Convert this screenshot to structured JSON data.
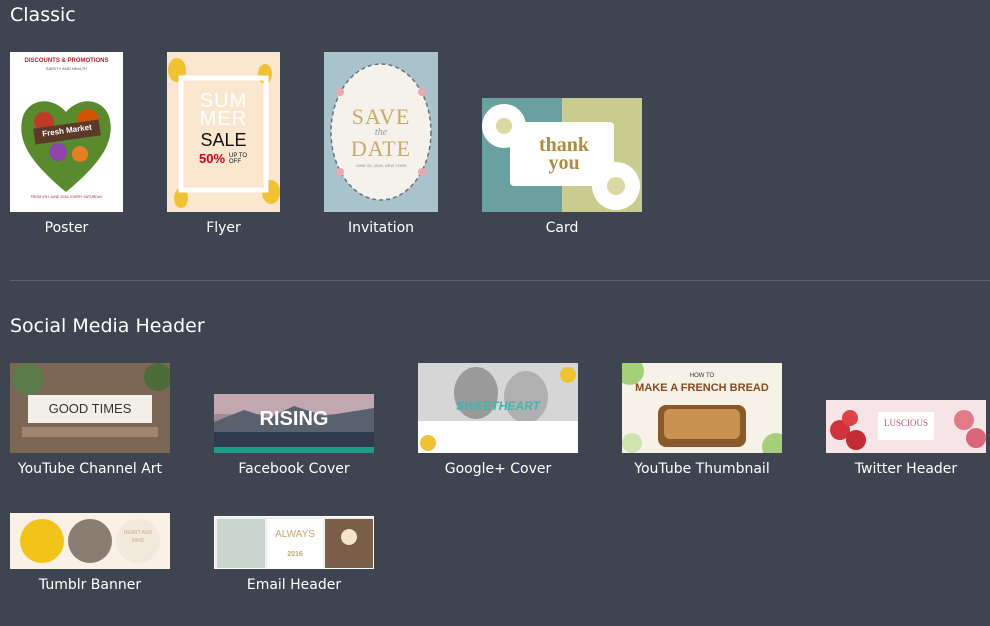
{
  "sections": {
    "classic": {
      "title": "Classic",
      "items": [
        {
          "label": "Poster",
          "thumb_text": {
            "header": "DISCOUNTS & PROMOTIONS",
            "sub": "SAFETY AND HEALTH",
            "ribbon": "Fresh Market",
            "footer": "FROM 4TH JUNE 2016, EVERY SATURDAY"
          }
        },
        {
          "label": "Flyer",
          "thumb_text": {
            "line1": "SUM",
            "line2": "MER",
            "line3": "SALE",
            "line4": "50%",
            "line5": "UP TO OFF"
          }
        },
        {
          "label": "Invitation",
          "thumb_text": {
            "line1": "SAVE",
            "line2": "the",
            "line3": "DATE",
            "line4": "JUNE 20, 2016, NEW YORK"
          }
        },
        {
          "label": "Card",
          "thumb_text": {
            "line1": "thank",
            "line2": "you"
          }
        }
      ]
    },
    "social": {
      "title": "Social Media Header",
      "items": [
        {
          "label": "YouTube Channel Art",
          "thumb_text": {
            "line1": "GOOD TIMES"
          }
        },
        {
          "label": "Facebook Cover",
          "thumb_text": {
            "line1": "RISING"
          }
        },
        {
          "label": "Google+ Cover",
          "thumb_text": {
            "line1": "SWEETHEART"
          }
        },
        {
          "label": "YouTube Thumbnail",
          "thumb_text": {
            "line0": "HOW TO",
            "line1": "MAKE A FRENCH BREAD"
          }
        },
        {
          "label": "Twitter Header",
          "thumb_text": {
            "line1": "LUSCIOUS"
          }
        },
        {
          "label": "Tumblr Banner",
          "thumb_text": {
            "line1": "HEART AND MIND"
          }
        },
        {
          "label": "Email Header",
          "thumb_text": {
            "line1": "ALWAYS",
            "line2": "2016"
          }
        }
      ]
    }
  },
  "colors": {
    "background": "#3f4451",
    "divider": "#5e6470",
    "label": "#ffffff"
  }
}
